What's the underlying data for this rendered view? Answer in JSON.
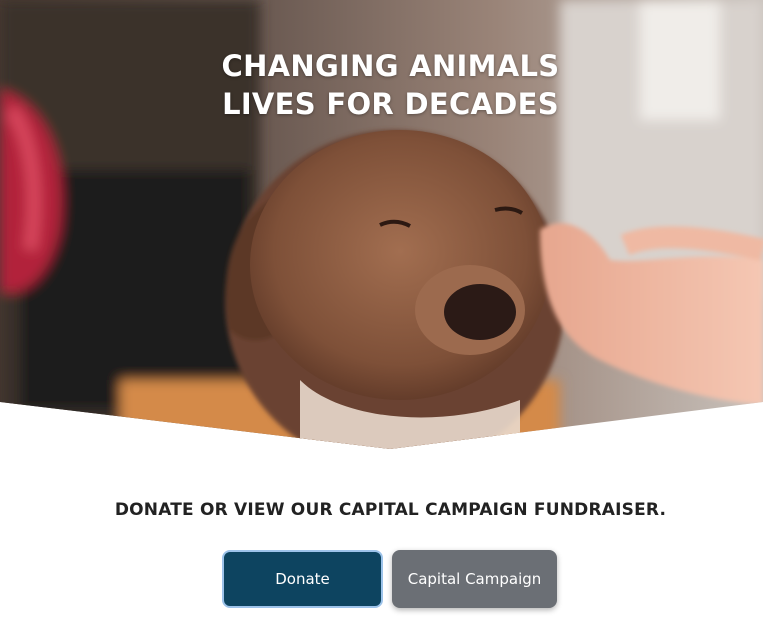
{
  "hero": {
    "image": "puppy-being-petted-photo",
    "title_line1": "CHANGING ANIMALS",
    "title_line2": "LIVES FOR DECADES"
  },
  "cta": {
    "heading": "DONATE OR VIEW OUR CAPITAL CAMPAIGN FUNDRAISER.",
    "donate_label": "Donate",
    "capital_label": "Capital Campaign"
  },
  "colors": {
    "donate_bg": "#0d4460",
    "donate_border": "#9dc3ea",
    "capital_bg": "#6b6f75",
    "heading_text": "#222222"
  }
}
